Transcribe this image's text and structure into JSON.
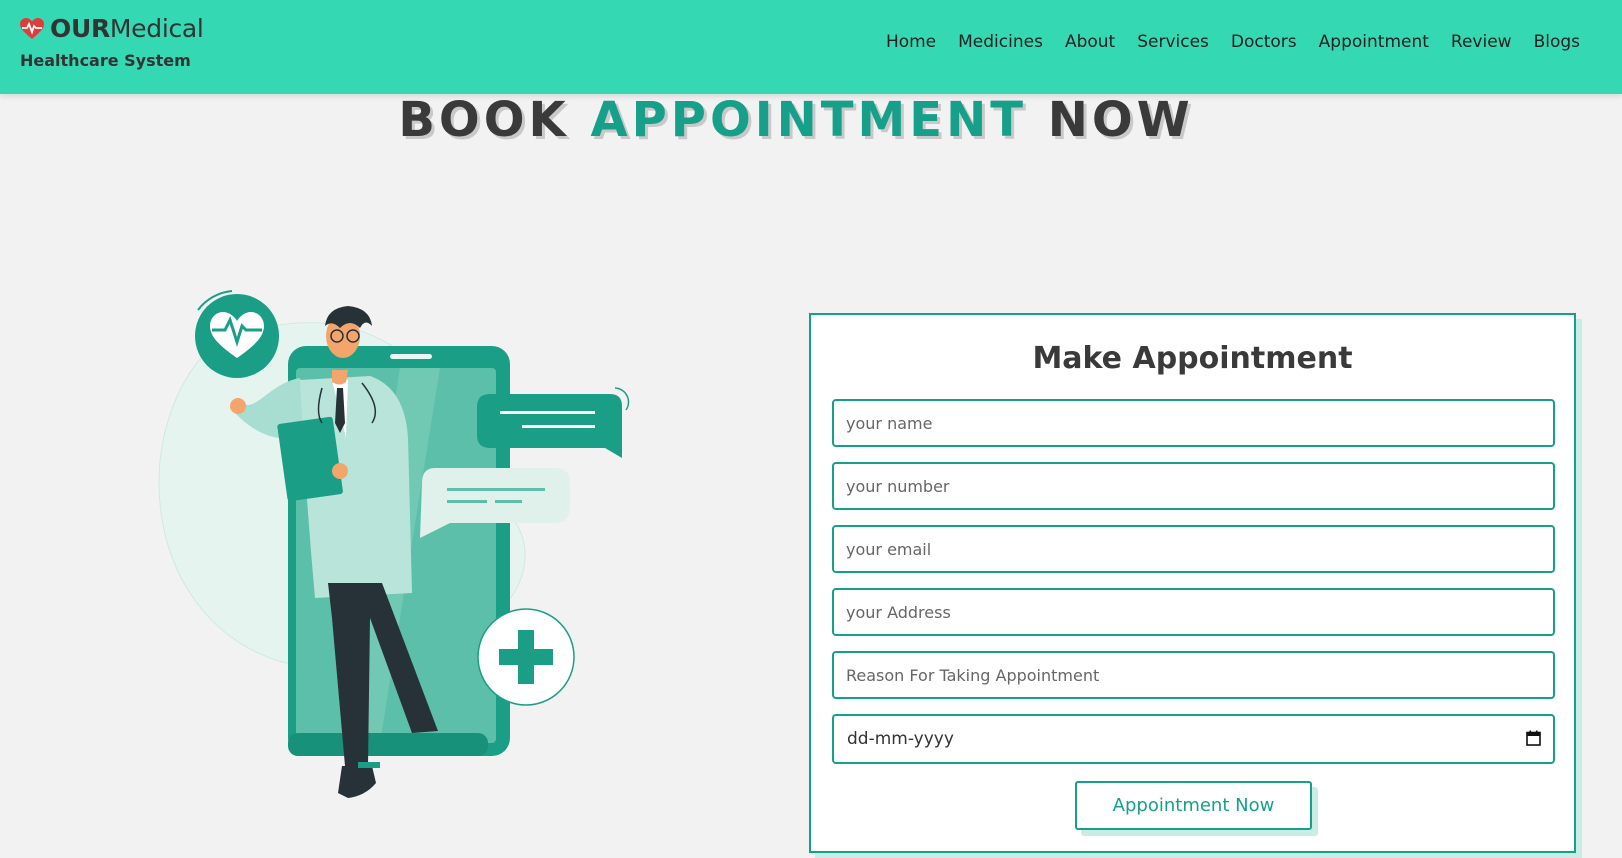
{
  "header": {
    "logo_strong": "OUR",
    "logo_light": "Medical",
    "tagline": "Healthcare System",
    "nav": [
      "Home",
      "Medicines",
      "About",
      "Services",
      "Doctors",
      "Appointment",
      "Review",
      "Blogs"
    ]
  },
  "section": {
    "heading_pre": "BOOK ",
    "heading_highlight": "APPOINTMENT",
    "heading_post": " NOW"
  },
  "form": {
    "title": "Make Appointment",
    "name_placeholder": "your name",
    "number_placeholder": "your number",
    "email_placeholder": "your email",
    "address_placeholder": "your Address",
    "reason_placeholder": "Reason For Taking Appointment",
    "date_placeholder": "dd-mm-yyyy",
    "submit_label": "Appointment Now"
  },
  "colors": {
    "header_bg": "#34d9b3",
    "accent": "#16a08a",
    "page_bg": "#f2f2f2",
    "heading_text": "#3a3a3a"
  },
  "icons": [
    "heart-pulse-icon",
    "calendar-icon",
    "plus-icon",
    "chat-bubble-icon"
  ]
}
